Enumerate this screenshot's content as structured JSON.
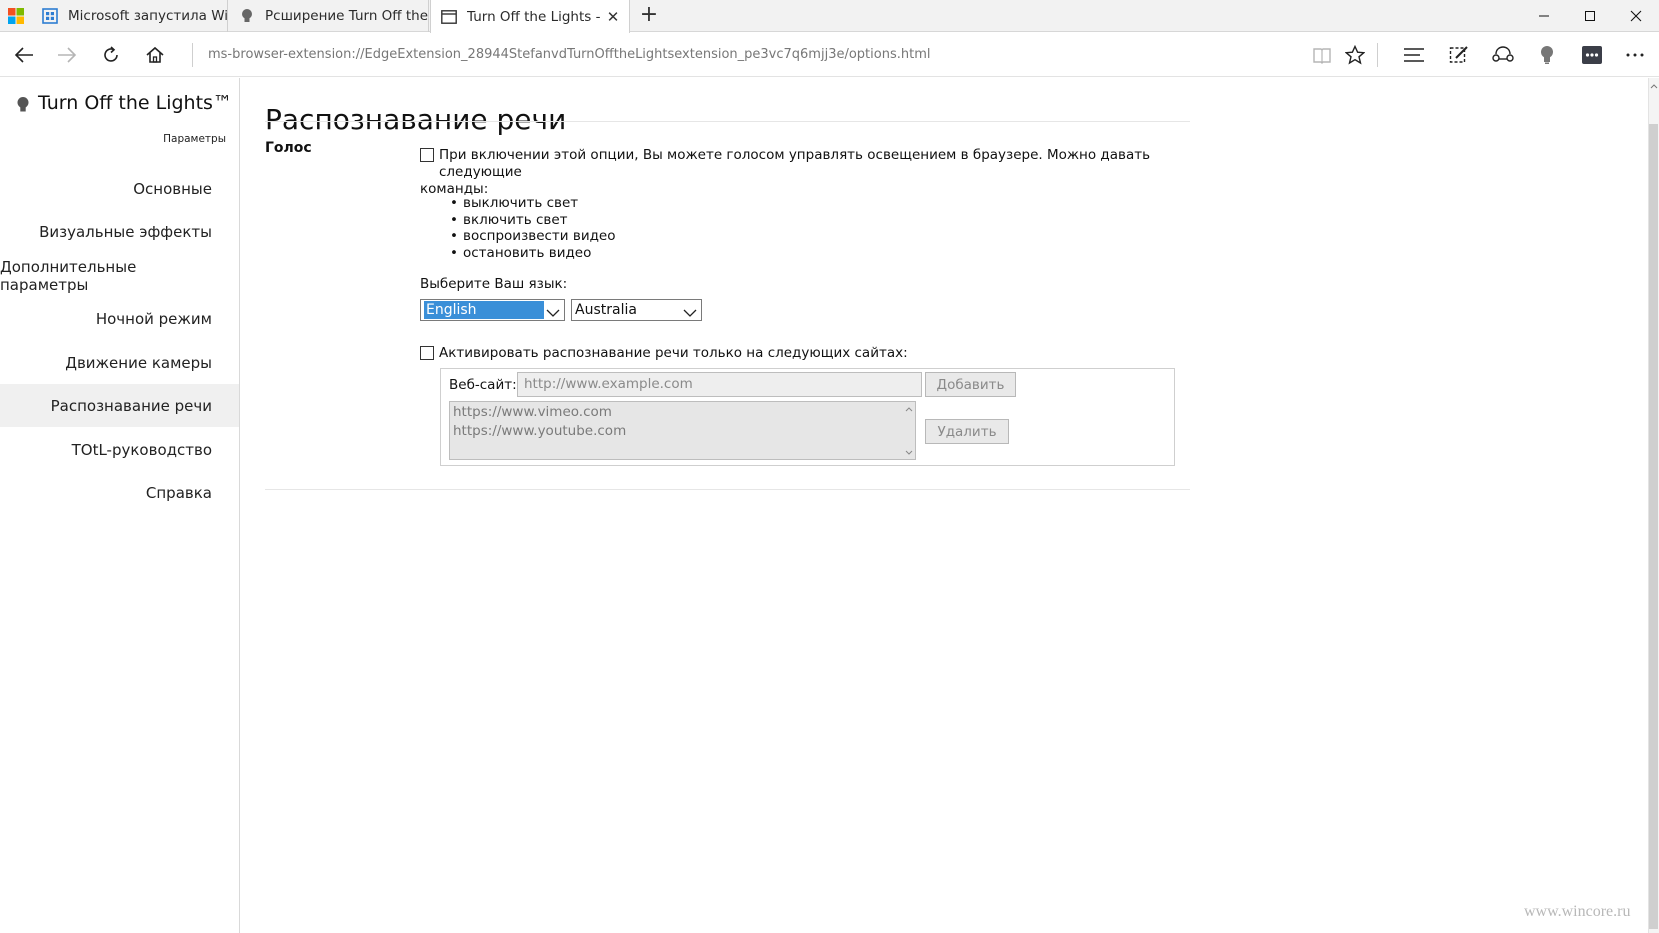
{
  "browser": {
    "tabs": [
      {
        "title": "Microsoft запустила Windo",
        "icon": "store-icon"
      },
      {
        "title": "Рсширение Turn Off the Lig",
        "icon": "bulb-icon"
      },
      {
        "title": "Turn Off the Lights - Or",
        "icon": "page-icon",
        "close": "✕"
      }
    ],
    "new_tab": "+",
    "url": "ms-browser-extension://EdgeExtension_28944StefanvdTurnOfftheLightsextension_pe3vc7q6mjj3e/options.html"
  },
  "sidebar": {
    "app_name": "Turn Off the Lights™",
    "subtitle": "Параметры",
    "items": [
      {
        "label": "Основные"
      },
      {
        "label": "Визуальные эффекты"
      },
      {
        "label": "Дополнительные параметры"
      },
      {
        "label": "Ночной режим"
      },
      {
        "label": "Движение камеры"
      },
      {
        "label": "Распознавание речи",
        "active": true
      },
      {
        "label": "TOtL-руководство"
      },
      {
        "label": "Справка"
      }
    ]
  },
  "main": {
    "title": "Распознавание речи",
    "section": "Голос",
    "voice_option": {
      "line1": "При включении этой опции, Вы можете голосом управлять освещением в браузере. Можно давать следующие",
      "line2": "команды:",
      "checked": false
    },
    "commands": [
      "выключить свет",
      "включить свет",
      "воспроизвести видео",
      "остановить видео"
    ],
    "language_label": "Выберите Ваш язык:",
    "language": "English",
    "region": "Australia",
    "sites_option": {
      "label": "Активировать распознавание речи только на следующих сайтах:",
      "checked": false
    },
    "website_label": "Веб-сайт:",
    "website_placeholder": "http://www.example.com",
    "add_button": "Добавить",
    "remove_button": "Удалить",
    "sites": [
      "https://www.vimeo.com",
      "https://www.youtube.com"
    ]
  },
  "watermark": "www.wincore.ru",
  "colors": {
    "accent": "#3a8fd8",
    "active_nav": "#f0f0f0"
  }
}
